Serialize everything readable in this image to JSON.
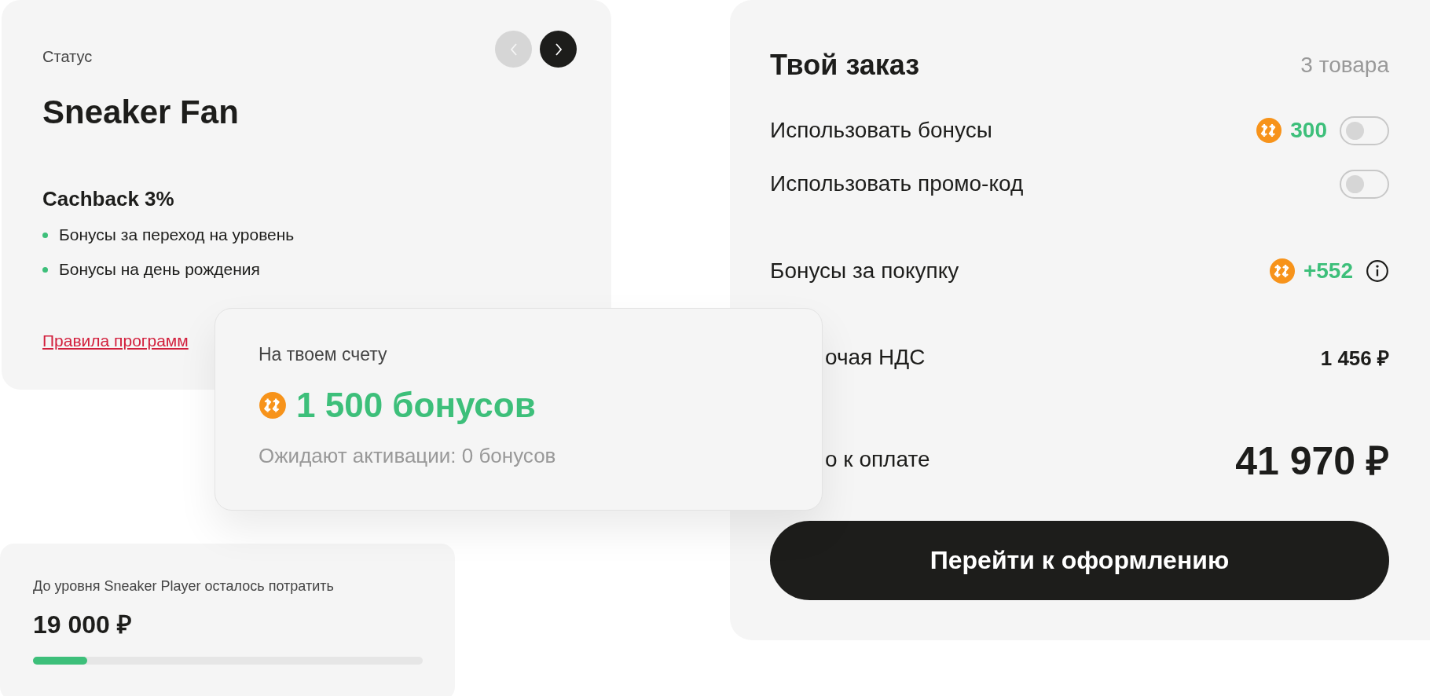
{
  "status_card": {
    "label": "Статус",
    "title": "Sneaker Fan",
    "nav": [
      {
        "kind": "prev",
        "disabled": true
      },
      {
        "kind": "next",
        "disabled": false
      }
    ],
    "perk_title": "Cachback 3%",
    "perks": [
      "Бонусы за переход на уровень",
      "Бонусы на день рождения"
    ],
    "rules_link": "Правила программ"
  },
  "balance_card": {
    "label": "На твоем счету",
    "amount": "1 500 бонусов",
    "pending": "Ожидают активации: 0 бонусов"
  },
  "progress_card": {
    "label": "До уровня Sneaker Player осталось потратить",
    "amount": "19 000 ₽",
    "level": 0.14
  },
  "order": {
    "title": "Твой заказ",
    "count": "3 товара",
    "options": [
      {
        "label": "Использовать бонусы",
        "bonus": "300",
        "on": false
      },
      {
        "label": "Использовать промо-код",
        "on": false
      }
    ],
    "purchase_bonus": {
      "label": "Бонусы за покупку",
      "value": "+552"
    },
    "vat": {
      "label": "очая НДС",
      "value": "1 456 ₽"
    },
    "total": {
      "label": "о к оплате",
      "value": "41 970 ₽"
    },
    "checkout_button": "Перейти к оформлению"
  }
}
